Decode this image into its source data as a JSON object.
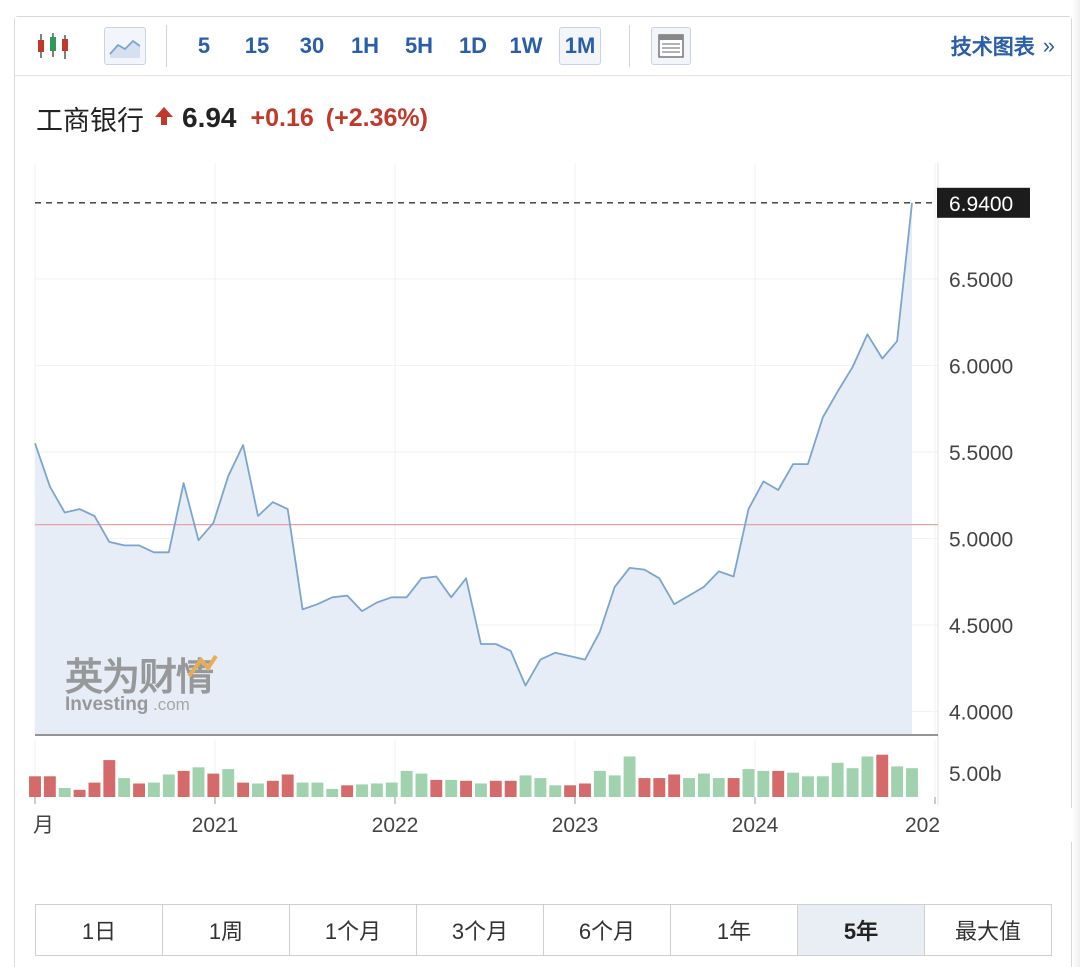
{
  "toolbar": {
    "chart_type_icons": [
      "candlestick-icon",
      "area-chart-icon"
    ],
    "intervals": [
      "5",
      "15",
      "30",
      "1H",
      "5H",
      "1D",
      "1W",
      "1M"
    ],
    "active_interval": "1M",
    "table_icon": "table-icon",
    "tech_chart_label": "技术图表",
    "tech_chart_chevron": "»"
  },
  "quote": {
    "name": "工商银行",
    "price": "6.94",
    "change": "+0.16",
    "change_pct": "(+2.36%)",
    "direction": "up",
    "up_color": "#c0392b"
  },
  "chart_data": {
    "type": "area",
    "x_labels": [
      "月",
      "2021",
      "2022",
      "2023",
      "2024",
      "202"
    ],
    "y_ticks": [
      "6.5000",
      "6.0000",
      "5.5000",
      "5.0000",
      "4.5000",
      "4.0000"
    ],
    "ylim": [
      3.87,
      7.17
    ],
    "last_price_label": "6.9400",
    "reference_line": 5.08,
    "line_color": "#7ca4d0",
    "fill_color": "#e6edf6",
    "watermark": {
      "cn": "英为财情",
      "en": "Investing",
      "suffix": ".com"
    },
    "price": [
      5.55,
      5.3,
      5.15,
      5.17,
      5.13,
      4.98,
      4.96,
      4.96,
      4.92,
      4.92,
      5.32,
      4.99,
      5.09,
      5.36,
      5.54,
      5.13,
      5.21,
      5.17,
      4.59,
      4.62,
      4.66,
      4.67,
      4.58,
      4.63,
      4.66,
      4.66,
      4.77,
      4.78,
      4.66,
      4.77,
      4.39,
      4.39,
      4.35,
      4.15,
      4.3,
      4.34,
      4.32,
      4.3,
      4.46,
      4.72,
      4.83,
      4.82,
      4.77,
      4.62,
      4.67,
      4.72,
      4.81,
      4.78,
      5.17,
      5.33,
      5.28,
      5.43,
      5.43,
      5.7,
      5.85,
      5.99,
      6.18,
      6.04,
      6.14,
      6.94
    ],
    "volume_label": "5.00b",
    "volume_colors": {
      "up": "#9fd2ad",
      "down": "#d46a6a"
    },
    "volume": [
      {
        "v": 2.3,
        "d": "down"
      },
      {
        "v": 2.3,
        "d": "down"
      },
      {
        "v": 1.0,
        "d": "up"
      },
      {
        "v": 0.8,
        "d": "down"
      },
      {
        "v": 1.6,
        "d": "down"
      },
      {
        "v": 4.1,
        "d": "down"
      },
      {
        "v": 2.1,
        "d": "up"
      },
      {
        "v": 1.5,
        "d": "down"
      },
      {
        "v": 1.6,
        "d": "up"
      },
      {
        "v": 2.5,
        "d": "up"
      },
      {
        "v": 2.9,
        "d": "down"
      },
      {
        "v": 3.3,
        "d": "up"
      },
      {
        "v": 2.6,
        "d": "down"
      },
      {
        "v": 3.1,
        "d": "up"
      },
      {
        "v": 1.6,
        "d": "down"
      },
      {
        "v": 1.5,
        "d": "up"
      },
      {
        "v": 1.8,
        "d": "down"
      },
      {
        "v": 2.5,
        "d": "down"
      },
      {
        "v": 1.6,
        "d": "up"
      },
      {
        "v": 1.6,
        "d": "up"
      },
      {
        "v": 0.9,
        "d": "up"
      },
      {
        "v": 1.3,
        "d": "down"
      },
      {
        "v": 1.4,
        "d": "up"
      },
      {
        "v": 1.5,
        "d": "up"
      },
      {
        "v": 1.6,
        "d": "up"
      },
      {
        "v": 2.9,
        "d": "up"
      },
      {
        "v": 2.6,
        "d": "up"
      },
      {
        "v": 1.9,
        "d": "down"
      },
      {
        "v": 1.9,
        "d": "up"
      },
      {
        "v": 1.8,
        "d": "down"
      },
      {
        "v": 1.5,
        "d": "up"
      },
      {
        "v": 1.8,
        "d": "down"
      },
      {
        "v": 1.8,
        "d": "down"
      },
      {
        "v": 2.4,
        "d": "up"
      },
      {
        "v": 2.1,
        "d": "up"
      },
      {
        "v": 1.3,
        "d": "up"
      },
      {
        "v": 1.3,
        "d": "down"
      },
      {
        "v": 1.5,
        "d": "down"
      },
      {
        "v": 2.9,
        "d": "up"
      },
      {
        "v": 2.4,
        "d": "up"
      },
      {
        "v": 4.5,
        "d": "up"
      },
      {
        "v": 2.1,
        "d": "down"
      },
      {
        "v": 2.1,
        "d": "down"
      },
      {
        "v": 2.5,
        "d": "down"
      },
      {
        "v": 2.1,
        "d": "up"
      },
      {
        "v": 2.6,
        "d": "up"
      },
      {
        "v": 2.1,
        "d": "up"
      },
      {
        "v": 2.1,
        "d": "down"
      },
      {
        "v": 3.1,
        "d": "up"
      },
      {
        "v": 2.9,
        "d": "up"
      },
      {
        "v": 2.9,
        "d": "down"
      },
      {
        "v": 2.7,
        "d": "up"
      },
      {
        "v": 2.3,
        "d": "up"
      },
      {
        "v": 2.3,
        "d": "up"
      },
      {
        "v": 3.8,
        "d": "up"
      },
      {
        "v": 3.2,
        "d": "up"
      },
      {
        "v": 4.5,
        "d": "up"
      },
      {
        "v": 4.7,
        "d": "down"
      },
      {
        "v": 3.4,
        "d": "up"
      },
      {
        "v": 3.2,
        "d": "up"
      }
    ]
  },
  "range_tabs": [
    "1日",
    "1周",
    "1个月",
    "3个月",
    "6个月",
    "1年",
    "5年",
    "最大值"
  ],
  "active_range": "5年"
}
